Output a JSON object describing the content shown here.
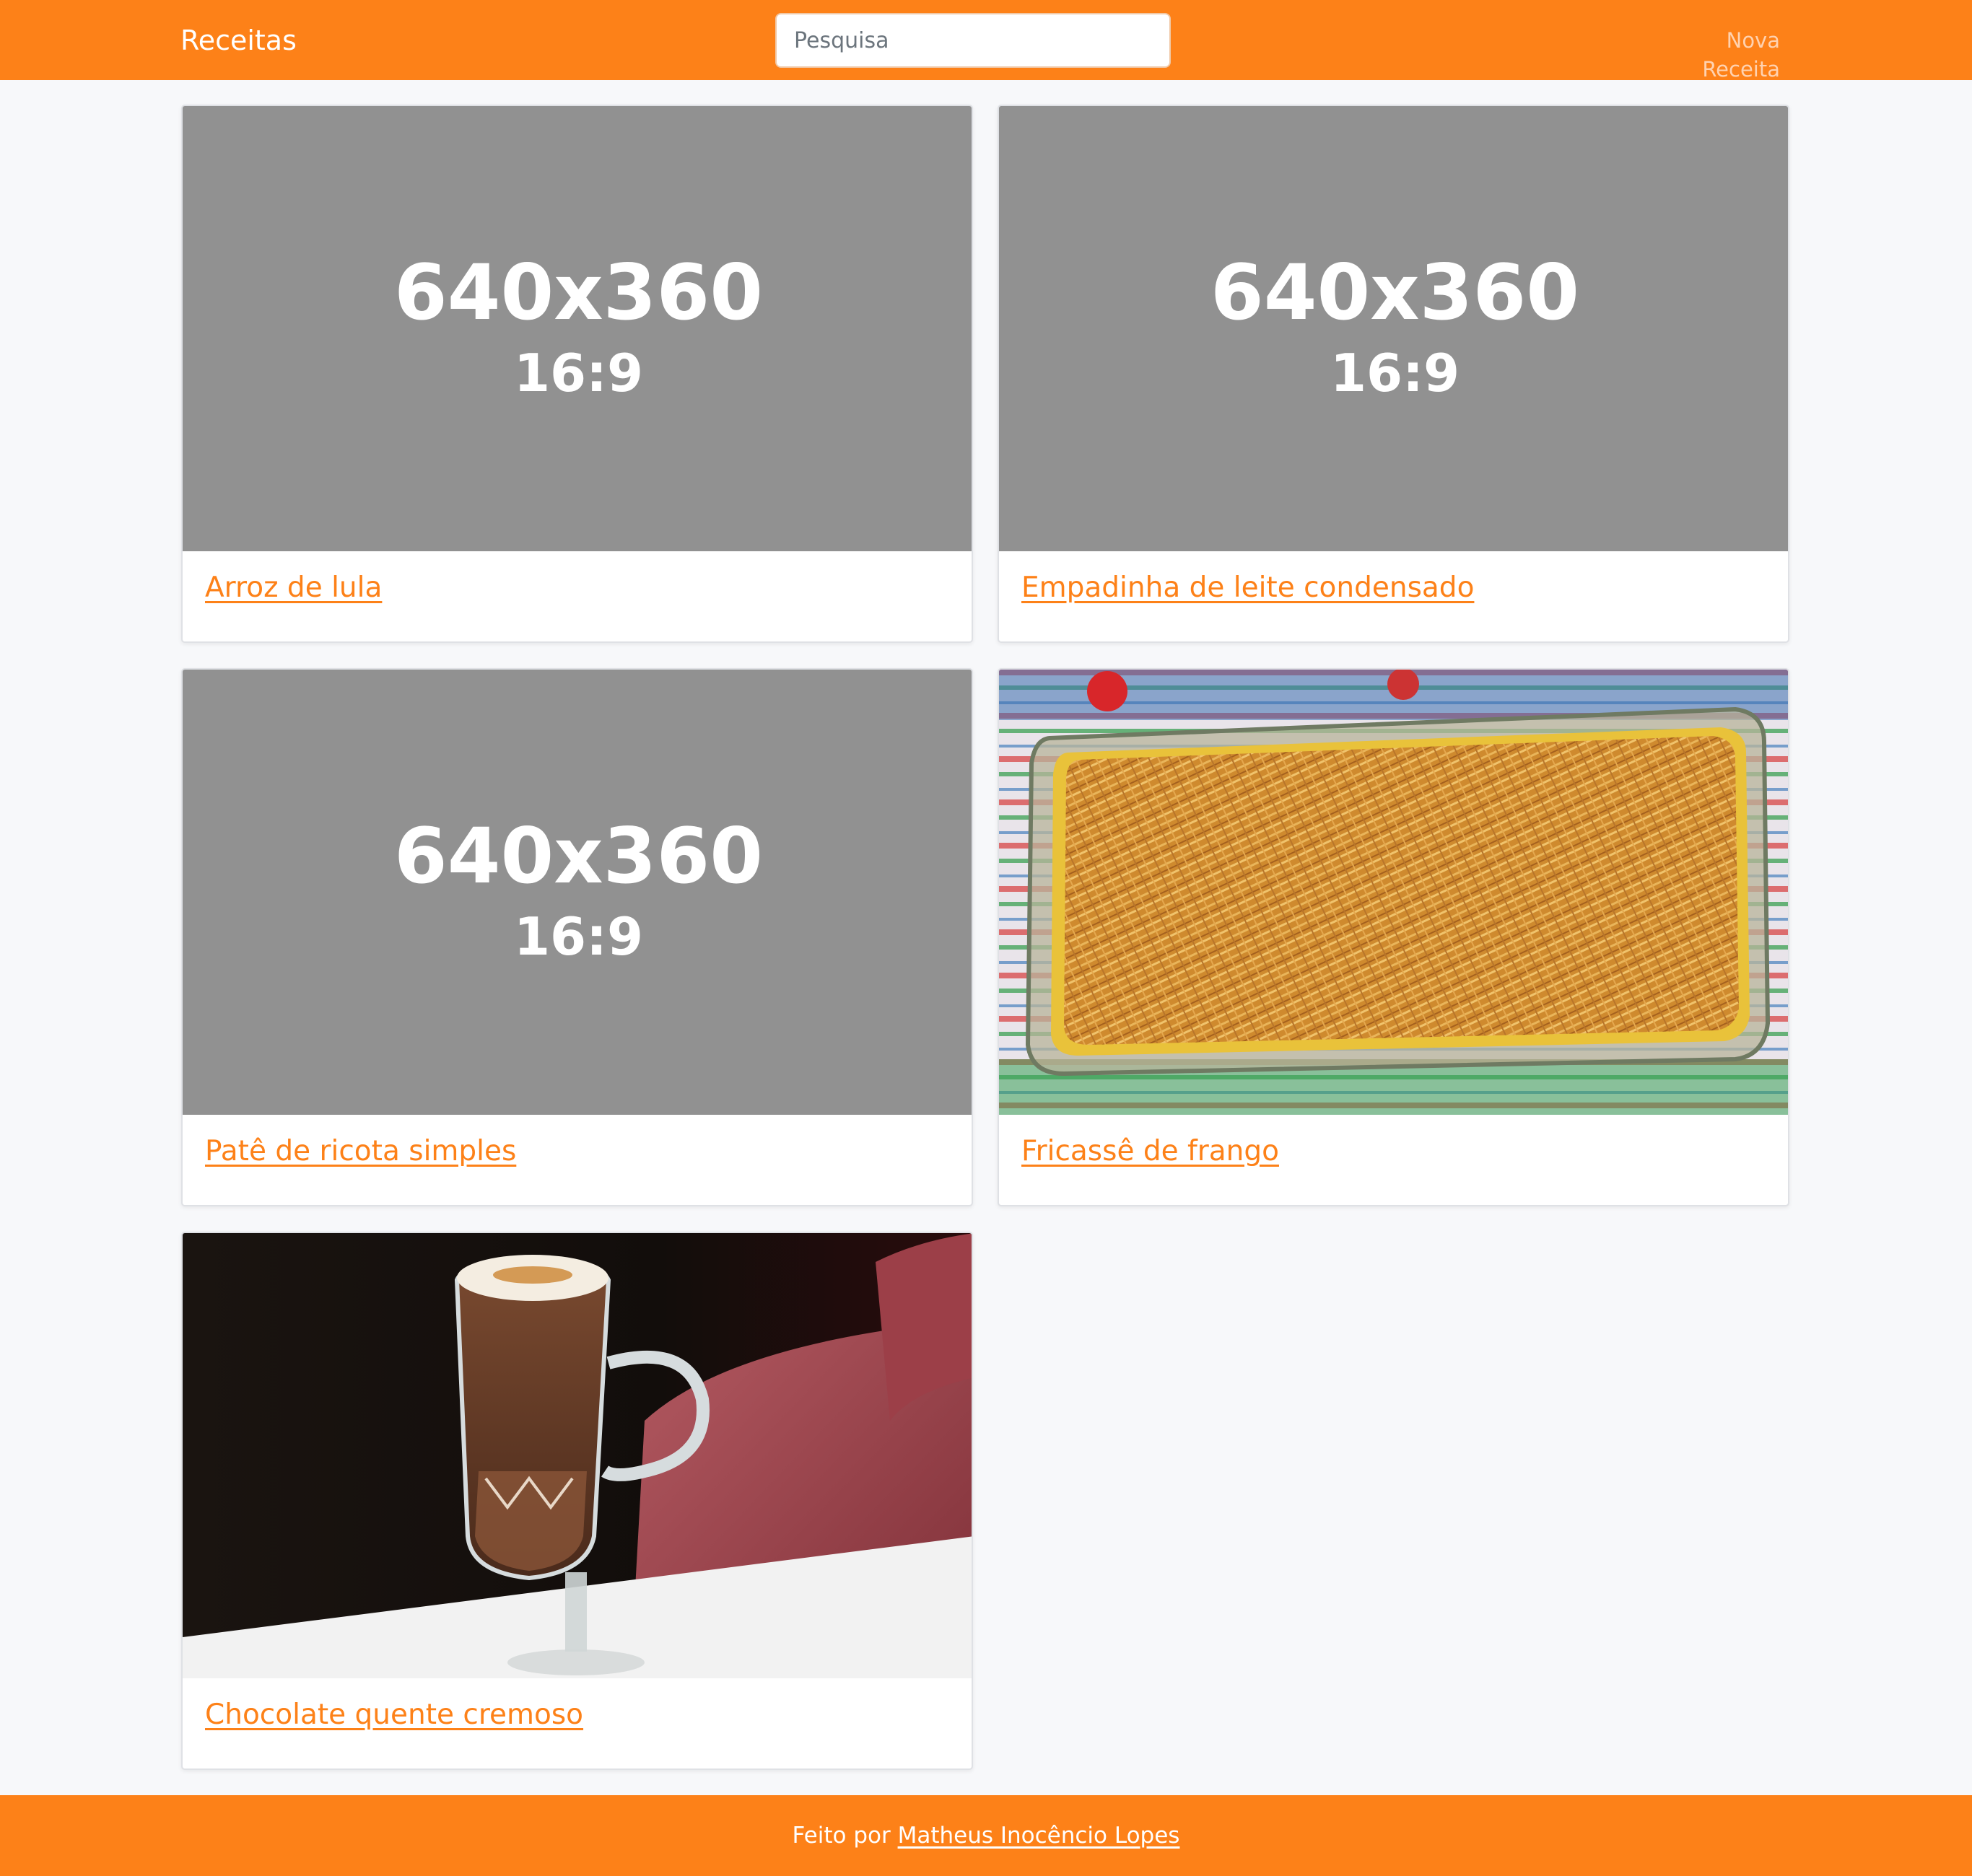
{
  "navbar": {
    "brand": "Receitas",
    "search_placeholder": "Pesquisa",
    "new_recipe_label": "Nova Receita"
  },
  "placeholder_image": {
    "dimensions_text": "640x360",
    "ratio_text": "16:9"
  },
  "recipes": [
    {
      "title": "Arroz de lula",
      "image": "placeholder"
    },
    {
      "title": "Empadinha de leite condensado",
      "image": "placeholder"
    },
    {
      "title": "Patê de ricota simples",
      "image": "placeholder"
    },
    {
      "title": "Fricassê de frango",
      "image": "photo-casserole-with-potato-sticks"
    },
    {
      "title": "Chocolate quente cremoso",
      "image": "photo-hot-chocolate-glass-mug"
    }
  ],
  "footer": {
    "prefix": "Feito por",
    "author": "Matheus Inocêncio Lopes"
  },
  "colors": {
    "brand_orange": "#fd8118",
    "page_background": "#f7f8fa",
    "placeholder_gray": "#919191"
  }
}
